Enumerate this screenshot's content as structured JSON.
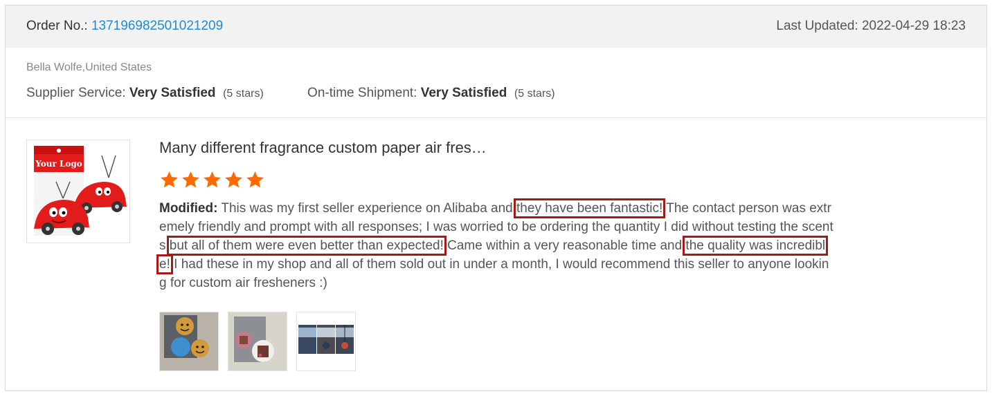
{
  "order": {
    "label": "Order No.:",
    "number": "137196982501021209",
    "last_updated": "Last Updated: 2022-04-29 18:23"
  },
  "buyer": "Bella Wolfe,United States",
  "ratings": {
    "supplier_service_label": "Supplier Service:",
    "supplier_service_value": "Very Satisfied",
    "supplier_service_stars": "(5 stars)",
    "shipment_label": "On-time Shipment:",
    "shipment_value": "Very Satisfied",
    "shipment_stars": "(5 stars)"
  },
  "product": {
    "title": "Many different fragrance custom paper air fres…",
    "thumb_text": "Your Logo",
    "star_rating": 5,
    "star_color": "#ff6a00"
  },
  "review": {
    "prefix": "Modified:",
    "part1": " This was my first seller experience on Alibaba and ",
    "highlight1": "they have been fantastic!",
    "part2": " The contact person was extremely friendly and prompt with all responses; I was worried to be ordering the quantity I did without testing the scents ",
    "highlight2": "but all of them were even better than expected!",
    "part3": " Came within a very reasonable time and ",
    "highlight3": "the quality was incredible!",
    "part4": " I had these in my shop and all of them sold out in under a month, I would recommend this seller to anyone looking for custom air fresheners :)"
  },
  "photos": [
    {
      "name": "smiley-freshener-photo"
    },
    {
      "name": "coffee-freshener-photo"
    },
    {
      "name": "car-mirror-photo"
    }
  ]
}
